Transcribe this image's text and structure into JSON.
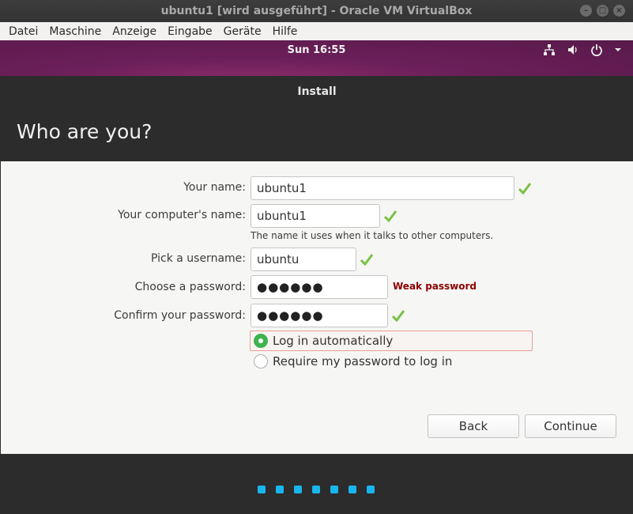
{
  "host": {
    "title": "ubuntu1 [wird ausgeführt] - Oracle VM VirtualBox",
    "window_buttons": [
      "minimize-icon",
      "maximize-icon",
      "close-icon"
    ],
    "menu": [
      "Datei",
      "Maschine",
      "Anzeige",
      "Eingabe",
      "Geräte",
      "Hilfe"
    ]
  },
  "panel": {
    "clock": "Sun 16:55",
    "tray_icons": [
      "network-icon",
      "volume-icon",
      "power-icon",
      "chevron-down-icon"
    ]
  },
  "installer": {
    "window_title": "Install",
    "heading": "Who are you?",
    "form": {
      "name_label": "Your name:",
      "name_value": "ubuntu1",
      "computer_label": "Your computer's name:",
      "computer_value": "ubuntu1",
      "computer_hint": "The name it uses when it talks to other computers.",
      "username_label": "Pick a username:",
      "username_value": "ubuntu",
      "password_label": "Choose a password:",
      "password_value": "●●●●●●",
      "password_strength": "Weak password",
      "confirm_label": "Confirm your password:",
      "confirm_value": "●●●●●●"
    },
    "login_options": {
      "auto": "Log in automatically",
      "require": "Require my password to log in",
      "selected": "auto"
    },
    "buttons": {
      "back": "Back",
      "continue": "Continue"
    },
    "progress": {
      "steps_total": 7,
      "color": "#19b6ee"
    }
  },
  "colors": {
    "panel_purple": "#6c1f5a",
    "check_green": "#7ac142",
    "radio_green": "#3eb34f",
    "weak_red": "#8b0000"
  }
}
